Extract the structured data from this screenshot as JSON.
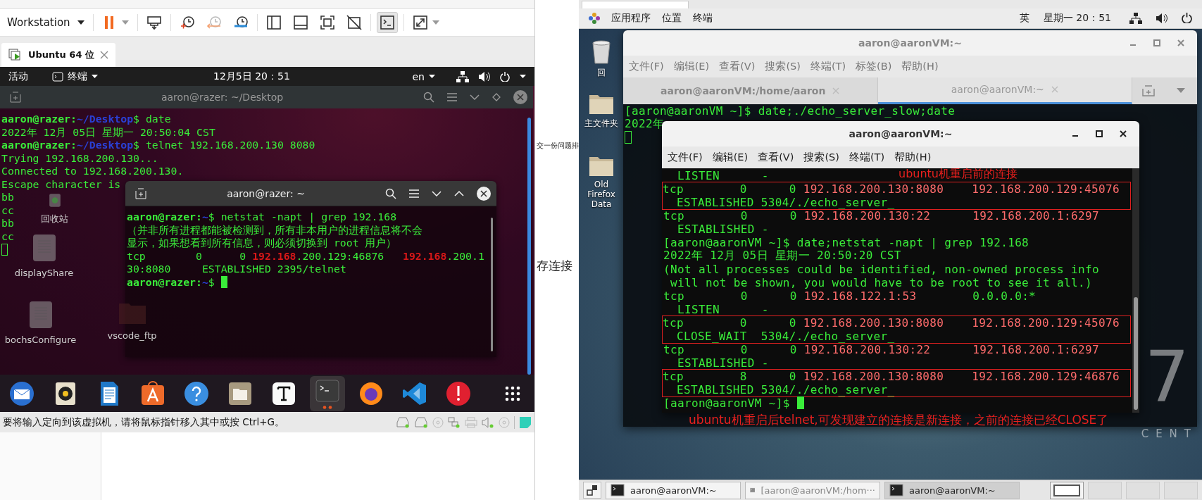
{
  "vmware": {
    "toolbar": {
      "menu": "Workstation",
      "groups": [
        [
          {
            "kind": "pause",
            "selected": false
          }
        ],
        [
          {
            "kind": "send",
            "selected": false
          }
        ],
        [
          {
            "kind": "snapshot",
            "selected": false
          },
          {
            "kind": "revert",
            "selected": false
          },
          {
            "kind": "manager",
            "selected": false
          }
        ],
        [
          {
            "kind": "sidebar",
            "selected": false
          },
          {
            "kind": "thumbs",
            "selected": false
          },
          {
            "kind": "fullscreen",
            "selected": false
          },
          {
            "kind": "unity",
            "selected": false
          }
        ],
        [
          {
            "kind": "console",
            "selected": true
          }
        ],
        [
          {
            "kind": "stretch",
            "selected": false
          }
        ]
      ]
    },
    "tab": {
      "label": "Ubuntu 64 位"
    },
    "topbar": {
      "activities": "活动",
      "app": "终端",
      "clock": "12月5日  20：51",
      "input": "en"
    },
    "desktop_icons": [
      {
        "kind": "trash",
        "label": "回收站"
      },
      {
        "kind": "file",
        "label": "displayShare"
      },
      {
        "kind": "file",
        "label": "bochsConfigure"
      },
      {
        "kind": "folder",
        "label": "vscode_ftp"
      }
    ],
    "back_terminal": {
      "title": "aaron@razer: ~/Desktop",
      "focused": false,
      "lines": [
        {
          "segs": [
            {
              "text": "aaron@razer:",
              "kind": "user"
            },
            {
              "text": "~/Desktop",
              "kind": "path"
            },
            {
              "text": "$ date",
              "kind": "text"
            }
          ]
        },
        {
          "segs": [
            {
              "text": "2022年 12月 05日 星期一 20:50:04 CST",
              "kind": "text"
            }
          ]
        },
        {
          "segs": [
            {
              "text": "aaron@razer:",
              "kind": "user"
            },
            {
              "text": "~/Desktop",
              "kind": "path"
            },
            {
              "text": "$ telnet 192.168.200.130 8080",
              "kind": "text"
            }
          ]
        },
        {
          "segs": [
            {
              "text": "Trying 192.168.200.130...",
              "kind": "text"
            }
          ]
        },
        {
          "segs": [
            {
              "text": "Connected to 192.168.200.130.",
              "kind": "text"
            }
          ]
        },
        {
          "segs": [
            {
              "text": "Escape character is",
              "kind": "text"
            }
          ]
        },
        {
          "segs": [
            {
              "text": "bb",
              "kind": "text"
            }
          ]
        },
        {
          "segs": [
            {
              "text": "cc",
              "kind": "text"
            }
          ]
        },
        {
          "segs": [
            {
              "text": "bb",
              "kind": "text"
            }
          ]
        },
        {
          "segs": [
            {
              "text": "cc",
              "kind": "text"
            }
          ]
        },
        {
          "cursor": true
        }
      ]
    },
    "front_terminal": {
      "title": "aaron@razer: ~",
      "focused": true,
      "lines": [
        {
          "segs": [
            {
              "text": "aaron@razer:",
              "kind": "user"
            },
            {
              "text": "~",
              "kind": "path"
            },
            {
              "text": "$ netstat -napt | grep 192.168",
              "kind": "text"
            }
          ]
        },
        {
          "segs": [
            {
              "text": "（并非所有进程都能被检测到，所有非本用户的进程信息将不会",
              "kind": "text"
            }
          ]
        },
        {
          "segs": [
            {
              "text": "显示，如果想看到所有信息，则必须切换到 root 用户）",
              "kind": "text"
            }
          ]
        },
        {
          "segs": [
            {
              "text": "tcp        0      0 ",
              "kind": "text"
            },
            {
              "text": "192.168",
              "kind": "match"
            },
            {
              "text": ".200.129:46876   ",
              "kind": "text"
            },
            {
              "text": "192.168",
              "kind": "match"
            },
            {
              "text": ".200.1",
              "kind": "text"
            }
          ]
        },
        {
          "segs": [
            {
              "text": "30:8080     ESTABLISHED 2395/telnet",
              "kind": "text"
            }
          ]
        },
        {
          "segs": [
            {
              "text": "aaron@razer:",
              "kind": "user"
            },
            {
              "text": "~",
              "kind": "path"
            },
            {
              "text": "$ ",
              "kind": "text"
            }
          ],
          "cursor": true
        }
      ]
    },
    "dock": [
      {
        "kind": "mail",
        "selected": false
      },
      {
        "kind": "speaker",
        "selected": false
      },
      {
        "kind": "document",
        "selected": false
      },
      {
        "kind": "store",
        "selected": false
      },
      {
        "kind": "help",
        "selected": false
      },
      {
        "kind": "folder",
        "selected": false
      },
      {
        "kind": "typora",
        "selected": false
      },
      {
        "kind": "terminal",
        "selected": true
      },
      {
        "kind": "browser",
        "selected": false
      },
      {
        "kind": "code",
        "selected": false
      },
      {
        "kind": "alert",
        "selected": false
      },
      {
        "kind": "grid",
        "selected": false
      }
    ],
    "status_bar": {
      "text": "要将输入定向到该虚拟机，请将鼠标指针移入其中或按 Ctrl+G。"
    }
  },
  "middle": {
    "texts": [
      "交一份问题排",
      "存连接"
    ]
  },
  "centos": {
    "topbar": {
      "menus": [
        "应用程序",
        "位置",
        "终端"
      ],
      "input": "英",
      "clock": "星期一 20：51"
    },
    "desktop_icons": [
      {
        "kind": "trash",
        "label": "回"
      },
      {
        "kind": "folder",
        "label": "主文件夹"
      },
      {
        "kind": "folder",
        "label": "Old Firefox Data"
      }
    ],
    "wallpaper": {
      "digit": "7",
      "word": "CENT"
    },
    "back_window": {
      "title": "aaron@aaronVM:~",
      "focused": false,
      "menu": [
        "文件(F)",
        "编辑(E)",
        "查看(V)",
        "搜索(S)",
        "终端(T)",
        "标签(B)",
        "帮助(H)"
      ],
      "tabs": [
        {
          "label": "aaron@aaronVM:/home/aaron",
          "selected": false
        },
        {
          "label": "aaron@aaronVM:~",
          "selected": true
        }
      ],
      "lines": [
        {
          "segs": [
            {
              "text": "[aaron@aaronVM ~]$ date;./echo_server_slow;date",
              "kind": "text"
            }
          ]
        },
        {
          "segs": [
            {
              "text": "2022年",
              "kind": "text"
            }
          ]
        },
        {
          "cursor": true
        }
      ]
    },
    "front_window": {
      "title": "aaron@aaronVM:~",
      "focused": true,
      "menu": [
        "文件(F)",
        "编辑(E)",
        "查看(V)",
        "搜索(S)",
        "终端(T)",
        "帮助(H)"
      ],
      "annotation": "ubuntu机重启前的连接",
      "blocks": [
        {
          "boxed": false,
          "lines": [
            {
              "segs": [
                {
                  "text": "  LISTEN      -",
                  "kind": "text"
                }
              ]
            }
          ]
        },
        {
          "boxed": true,
          "lines": [
            {
              "segs": [
                {
                  "text": "tcp        0      0 ",
                  "kind": "text"
                },
                {
                  "text": "192.168.200.130:8080",
                  "kind": "ip"
                },
                {
                  "text": "    192.168.200.129:45076",
                  "kind": "ip"
                }
              ]
            },
            {
              "segs": [
                {
                  "text": "  ESTABLISHED 5304/./echo_server_",
                  "kind": "text"
                }
              ]
            }
          ]
        },
        {
          "boxed": false,
          "lines": [
            {
              "segs": [
                {
                  "text": "tcp        0      0 ",
                  "kind": "text"
                },
                {
                  "text": "192.168.200.130:22",
                  "kind": "ip"
                },
                {
                  "text": "      192.168.200.1:6297",
                  "kind": "ip"
                }
              ]
            },
            {
              "segs": [
                {
                  "text": "  ESTABLISHED -",
                  "kind": "text"
                }
              ]
            },
            {
              "segs": [
                {
                  "text": "[aaron@aaronVM ~]$ date;netstat -napt | grep 192.168",
                  "kind": "text"
                }
              ]
            },
            {
              "segs": [
                {
                  "text": "2022年 12月 05日 星期一 20:50:20 CST",
                  "kind": "text"
                }
              ]
            },
            {
              "segs": [
                {
                  "text": "(Not all processes could be identified, non-owned process info",
                  "kind": "text"
                }
              ]
            },
            {
              "segs": [
                {
                  "text": " will not be shown, you would have to be root to see it all.)",
                  "kind": "text"
                }
              ]
            },
            {
              "segs": [
                {
                  "text": "tcp        0      0 ",
                  "kind": "text"
                },
                {
                  "text": "192.168.122.1:53",
                  "kind": "ip"
                },
                {
                  "text": "        0.0.0.0:*",
                  "kind": "text"
                }
              ]
            },
            {
              "segs": [
                {
                  "text": "  LISTEN      -",
                  "kind": "text"
                }
              ]
            }
          ]
        },
        {
          "boxed": true,
          "lines": [
            {
              "segs": [
                {
                  "text": "tcp        0      0 ",
                  "kind": "text"
                },
                {
                  "text": "192.168.200.130:8080",
                  "kind": "ip"
                },
                {
                  "text": "    192.168.200.129:45076",
                  "kind": "ip"
                }
              ]
            },
            {
              "segs": [
                {
                  "text": "  CLOSE_WAIT  5304/./echo_server_",
                  "kind": "text"
                }
              ]
            }
          ]
        },
        {
          "boxed": false,
          "lines": [
            {
              "segs": [
                {
                  "text": "tcp        0      0 ",
                  "kind": "text"
                },
                {
                  "text": "192.168.200.130:22",
                  "kind": "ip"
                },
                {
                  "text": "      192.168.200.1:6297",
                  "kind": "ip"
                }
              ]
            },
            {
              "segs": [
                {
                  "text": "  ESTABLISHED -",
                  "kind": "text"
                }
              ]
            }
          ]
        },
        {
          "boxed": true,
          "lines": [
            {
              "segs": [
                {
                  "text": "tcp        8      0 ",
                  "kind": "text"
                },
                {
                  "text": "192.168.200.130:8080",
                  "kind": "ip"
                },
                {
                  "text": "    192.168.200.129:46876",
                  "kind": "ip"
                }
              ]
            },
            {
              "segs": [
                {
                  "text": "  ESTABLISHED 5304/./echo_server_",
                  "kind": "text"
                }
              ]
            }
          ]
        },
        {
          "boxed": false,
          "lines": [
            {
              "segs": [
                {
                  "text": "[aaron@aaronVM ~]$ ",
                  "kind": "text"
                }
              ],
              "cursor": true
            }
          ]
        }
      ]
    },
    "note": "ubuntu机重启后telnet,可发现建立的连接是新连接，之前的连接已经CLOSE了",
    "taskbar": {
      "tasks": [
        {
          "label": "aaron@aaronVM:~",
          "selected": false,
          "minimized": false
        },
        {
          "label": "[aaron@aaronVM:/hom···",
          "selected": false,
          "minimized": true
        },
        {
          "label": "aaron@aaronVM:~",
          "selected": true,
          "minimized": false
        }
      ],
      "workspaces": [
        {
          "selected": true
        },
        {
          "selected": false
        },
        {
          "selected": false
        },
        {
          "selected": false
        }
      ]
    }
  }
}
